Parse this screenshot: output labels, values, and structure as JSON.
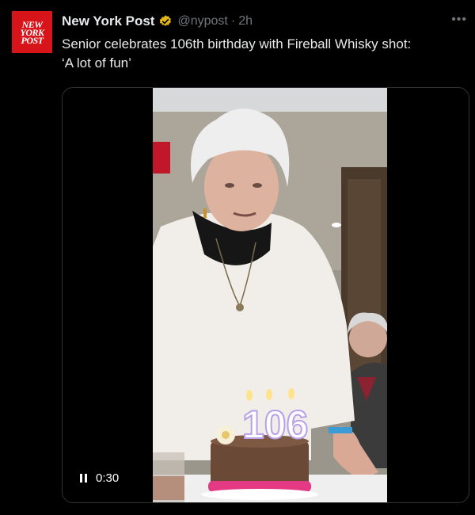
{
  "tweet": {
    "author_name": "New York Post",
    "author_handle": "@nypost",
    "separator": "·",
    "time_ago": "2h",
    "more_icon": "more-dots-icon",
    "verified_icon": "verified-badge-icon",
    "avatar_logo_lines": [
      "NEW",
      "YORK",
      "POST"
    ],
    "text_line1": "Senior celebrates 106th birthday with Fireball Whisky shot:",
    "text_line2": "‘A lot of fun’"
  },
  "media": {
    "type": "video",
    "elapsed_time": "0:30",
    "playback_icon": "pause-icon",
    "candles_label": "106"
  },
  "colors": {
    "background": "#000000",
    "text_primary": "#e7e9ea",
    "text_secondary": "#71767b",
    "brand_red": "#d7141a",
    "verified_gold": "#e2b719"
  }
}
